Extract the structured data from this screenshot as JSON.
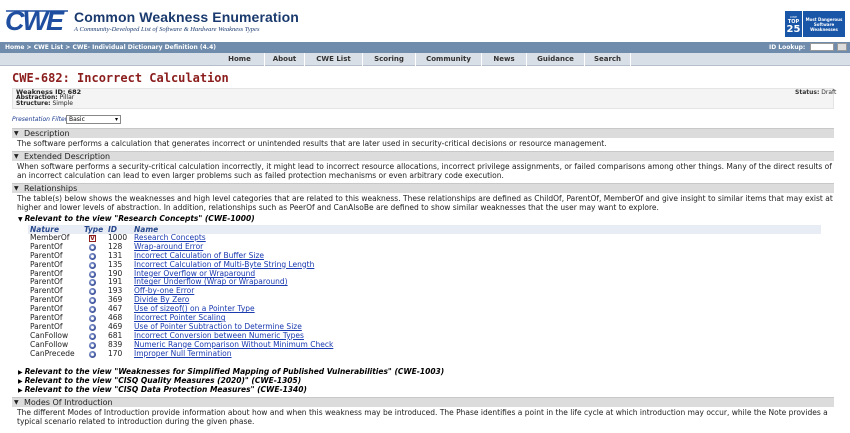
{
  "site": {
    "title": "Common Weakness Enumeration",
    "subtitle": "A Community-Developed List of Software & Hardware Weakness Types",
    "logo_text": "CWE",
    "top25": {
      "small": "CWE",
      "word": "TOP",
      "num": "25",
      "text": "Most Dangerous Software Weaknesses"
    }
  },
  "breadcrumb": {
    "home": "Home",
    "sep1": " > ",
    "list": "CWE List",
    "sep2": " > ",
    "current": "CWE- Individual Dictionary Definition (4.4)",
    "id_lookup_label": "ID Lookup:"
  },
  "nav": [
    "Home",
    "About",
    "CWE List",
    "Scoring",
    "Community",
    "News",
    "Guidance",
    "Search"
  ],
  "page": {
    "title": "CWE-682: Incorrect Calculation",
    "weakness_id_label": "Weakness ID:",
    "weakness_id": "682",
    "abstraction_label": "Abstraction:",
    "abstraction": "Pillar",
    "structure_label": "Structure:",
    "structure": "Simple",
    "status_label": "Status:",
    "status": "Draft",
    "presentation_filter_label": "Presentation Filter:",
    "presentation_filter_value": "Basic"
  },
  "sections": {
    "description": {
      "title": "Description",
      "text": "The software performs a calculation that generates incorrect or unintended results that are later used in security-critical decisions or resource management."
    },
    "extended": {
      "title": "Extended Description",
      "text": "When software performs a security-critical calculation incorrectly, it might lead to incorrect resource allocations, incorrect privilege assignments, or failed comparisons among other things. Many of the direct results of an incorrect calculation can lead to even larger problems such as failed protection mechanisms or even arbitrary code execution."
    },
    "relationships": {
      "title": "Relationships",
      "text": "The table(s) below shows the weaknesses and high level categories that are related to this weakness. These relationships are defined as ChildOf, ParentOf, MemberOf and give insight to similar items that may exist at higher and lower levels of abstraction. In addition, relationships such as PeerOf and CanAlsoBe are defined to show similar weaknesses that the user may want to explore.",
      "view_research": "Relevant to the view \"Research Concepts\" (CWE-1000)",
      "columns": [
        "Nature",
        "Type",
        "ID",
        "Name"
      ],
      "rows": [
        {
          "nature": "MemberOf",
          "type": "view",
          "id": "1000",
          "name": "Research Concepts"
        },
        {
          "nature": "ParentOf",
          "type": "base",
          "id": "128",
          "name": "Wrap-around Error"
        },
        {
          "nature": "ParentOf",
          "type": "base",
          "id": "131",
          "name": "Incorrect Calculation of Buffer Size"
        },
        {
          "nature": "ParentOf",
          "type": "base",
          "id": "135",
          "name": "Incorrect Calculation of Multi-Byte String Length"
        },
        {
          "nature": "ParentOf",
          "type": "base",
          "id": "190",
          "name": "Integer Overflow or Wraparound"
        },
        {
          "nature": "ParentOf",
          "type": "base",
          "id": "191",
          "name": "Integer Underflow (Wrap or Wraparound)"
        },
        {
          "nature": "ParentOf",
          "type": "base",
          "id": "193",
          "name": "Off-by-one Error"
        },
        {
          "nature": "ParentOf",
          "type": "base",
          "id": "369",
          "name": "Divide By Zero"
        },
        {
          "nature": "ParentOf",
          "type": "base",
          "id": "467",
          "name": "Use of sizeof() on a Pointer Type"
        },
        {
          "nature": "ParentOf",
          "type": "base",
          "id": "468",
          "name": "Incorrect Pointer Scaling"
        },
        {
          "nature": "ParentOf",
          "type": "base",
          "id": "469",
          "name": "Use of Pointer Subtraction to Determine Size"
        },
        {
          "nature": "CanFollow",
          "type": "base",
          "id": "681",
          "name": "Incorrect Conversion between Numeric Types"
        },
        {
          "nature": "CanFollow",
          "type": "base",
          "id": "839",
          "name": "Numeric Range Comparison Without Minimum Check"
        },
        {
          "nature": "CanPrecede",
          "type": "base",
          "id": "170",
          "name": "Improper Null Termination"
        }
      ],
      "view_1003": "Relevant to the view \"Weaknesses for Simplified Mapping of Published Vulnerabilities\" (CWE-1003)",
      "view_1305": "Relevant to the view \"CISQ Quality Measures (2020)\" (CWE-1305)",
      "view_1340": "Relevant to the view \"CISQ Data Protection Measures\" (CWE-1340)"
    },
    "modes": {
      "title": "Modes Of Introduction",
      "text": "The different Modes of Introduction provide information about how and when this weakness may be introduced. The Phase identifies a point in the life cycle at which introduction may occur, while the Note provides a typical scenario related to introduction during the given phase."
    }
  }
}
